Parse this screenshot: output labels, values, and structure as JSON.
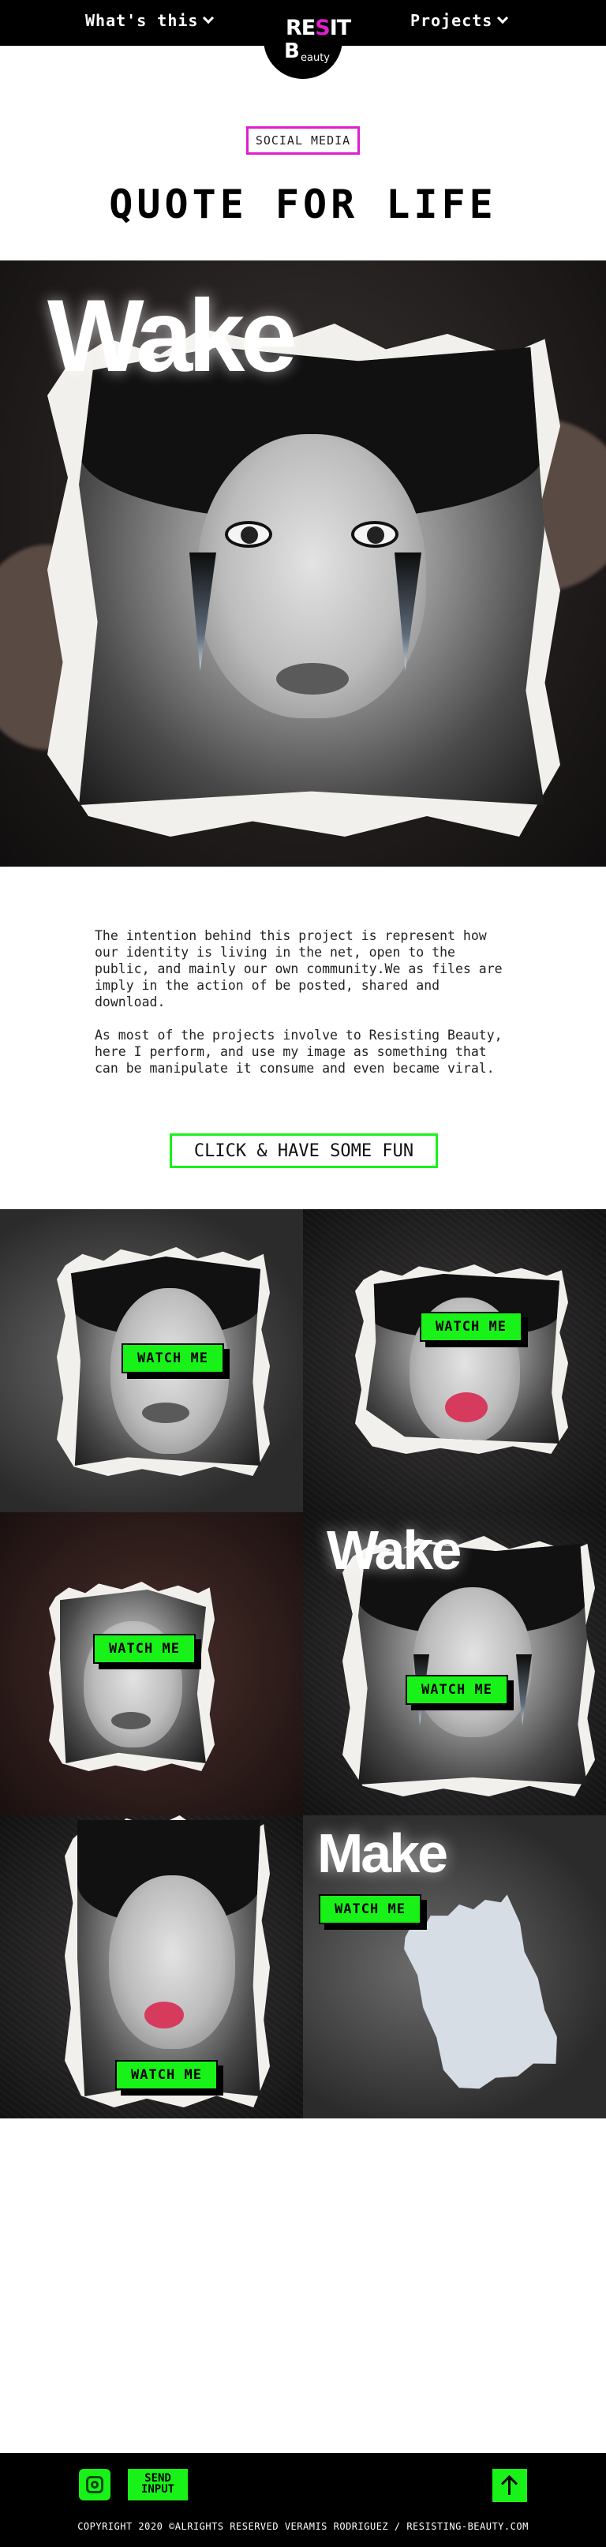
{
  "nav": {
    "left_label": "What's this",
    "right_label": "Projects",
    "logo_line1a": "RE",
    "logo_line1b": "S",
    "logo_line1c": "IT",
    "logo_line2": "B",
    "logo_line3": "eauty"
  },
  "header": {
    "tag": "SOCIAL MEDIA",
    "title": "QUOTE FOR LIFE"
  },
  "hero": {
    "overlay_word": "Wake"
  },
  "description": {
    "paragraph1": "The intention behind this project is represent how our identity is living in the net, open to the public, and mainly our own community.We as files are imply in the action of be posted, shared and download.",
    "paragraph2": "As most of the projects involve to Resisting Beauty, here I perform, and use my image as something that can be manipulate it consume and even became viral."
  },
  "cta": {
    "label": "CLICK & HAVE SOME FUN"
  },
  "gallery": {
    "watch_label": "WATCH ME",
    "tiles": [
      {
        "overlay_word": ""
      },
      {
        "overlay_word": ""
      },
      {
        "overlay_word": ""
      },
      {
        "overlay_word": "Wake"
      },
      {
        "overlay_word": ""
      },
      {
        "overlay_word": "Make"
      }
    ]
  },
  "footer": {
    "send_line1": "SEND",
    "send_line2": "INPUT",
    "copyright": "COPYRIGHT 2020 ©ALRIGHTS RESERVED VERAMIS RODRIGUEZ  / RESISTING-BEAUTY.COM"
  },
  "colors": {
    "accent_green": "#19f219",
    "accent_pink": "#e01ed0",
    "nav_bg": "#000000",
    "lip_red": "#d63a5c"
  },
  "icons": [
    "chevron-down-icon",
    "instagram-icon",
    "arrow-up-icon"
  ]
}
